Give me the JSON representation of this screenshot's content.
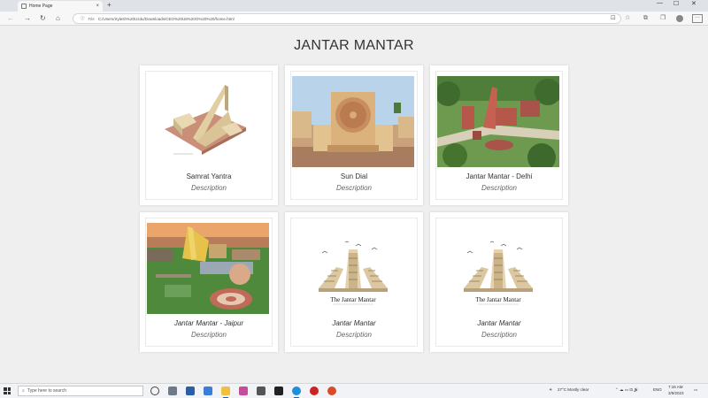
{
  "browser": {
    "tab_title": "Home Page",
    "tab_close": "×",
    "new_tab": "+",
    "minimize": "—",
    "maximize": "☐",
    "close": "✕",
    "url_label": "File",
    "url": "C:/Users/Sylesh%20Uzdu/Downloads/CEO%20U8%20O%20%20/home.html",
    "back": "←",
    "forward": "→",
    "reload": "↻",
    "home": "⌂",
    "more": "···"
  },
  "page": {
    "title": "JANTAR MANTAR",
    "cards": [
      {
        "name": "Samrat Yantra",
        "description": "Description",
        "image": "samrat-yantra-photo"
      },
      {
        "name": "Sun Dial",
        "description": "Description",
        "image": "sun-dial-photo"
      },
      {
        "name": "Jantar Mantar - Delhi",
        "description": "Description",
        "image": "delhi-photo"
      },
      {
        "name": "Jantar Mantar - Jaipur",
        "description": "Description",
        "image": "jaipur-photo"
      },
      {
        "name": "Jantar Mantar",
        "description": "Description",
        "image": "jantar-mantar-logo"
      },
      {
        "name": "Jantar Mantar",
        "description": "Description",
        "image": "jantar-mantar-logo"
      }
    ],
    "logo_text": "The Jantar Mantar"
  },
  "taskbar": {
    "search_placeholder": "Type here to search",
    "weather": "27°C  Mostly clear",
    "lang": "ENG",
    "time": "7:16 AM",
    "date": "3/9/2023"
  }
}
